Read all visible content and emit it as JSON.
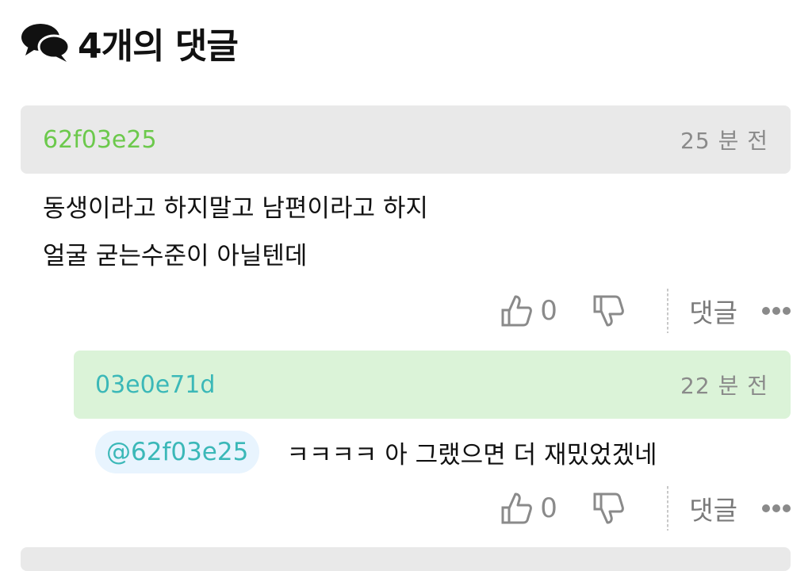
{
  "header": {
    "title": "4개의 댓글",
    "icon": "comments-icon"
  },
  "comments": [
    {
      "author": "62f03e25",
      "time": "25 분 전",
      "lines": [
        "동생이라고 하지말고 남편이라고 하지",
        "얼굴 굳는수준이 아닐텐데"
      ],
      "likes": "0",
      "reply_label": "댓글",
      "author_color": "#6cc94c",
      "head_bg": "#e9e9e9"
    },
    {
      "author": "03e0e71d",
      "time": "22 분 전",
      "mention": "@62f03e25",
      "text": "ㅋㅋㅋㅋ 아 그랬으면 더 재밌었겠네",
      "likes": "0",
      "reply_label": "댓글",
      "author_color": "#3bb8b8",
      "head_bg": "#dbf3d8"
    }
  ],
  "icons": {
    "like": "thumbs-up-icon",
    "dislike": "thumbs-down-icon",
    "more": "more-dots-icon"
  }
}
